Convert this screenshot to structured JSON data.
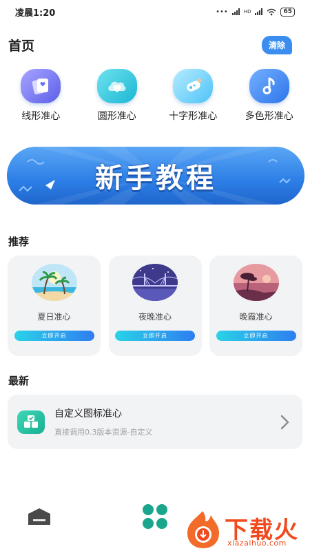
{
  "status_bar": {
    "time": "凌晨1:20",
    "signal_label": "HD",
    "battery": "65"
  },
  "header": {
    "title": "首页",
    "clear_label": "清除"
  },
  "categories": [
    {
      "label": "线形准心",
      "icon": "cards-icon"
    },
    {
      "label": "圆形准心",
      "icon": "cloud-heart-icon"
    },
    {
      "label": "十字形准心",
      "icon": "bottle-icon"
    },
    {
      "label": "多色形准心",
      "icon": "music-note-icon"
    }
  ],
  "banner": {
    "text": "新手教程"
  },
  "recommend": {
    "title": "推荐",
    "items": [
      {
        "name": "夏日准心",
        "button": "立即开启",
        "image": "beach-palm-image"
      },
      {
        "name": "夜晚准心",
        "button": "立即开启",
        "image": "night-bridge-image"
      },
      {
        "name": "晚霞准心",
        "button": "立即开启",
        "image": "sunset-tree-image"
      }
    ]
  },
  "latest": {
    "title": "最新",
    "item": {
      "title": "自定义图标准心",
      "subtitle": "直接调用0.3版本资源-自定义"
    }
  },
  "watermark": {
    "text": "下载火",
    "sub": "xiazaihuo.com"
  },
  "colors": {
    "accent": "#3b8ef0",
    "banner": "#2c7ee6",
    "card_bg": "#f2f3f5",
    "teal": "#19b092",
    "watermark": "#f04a1f"
  }
}
